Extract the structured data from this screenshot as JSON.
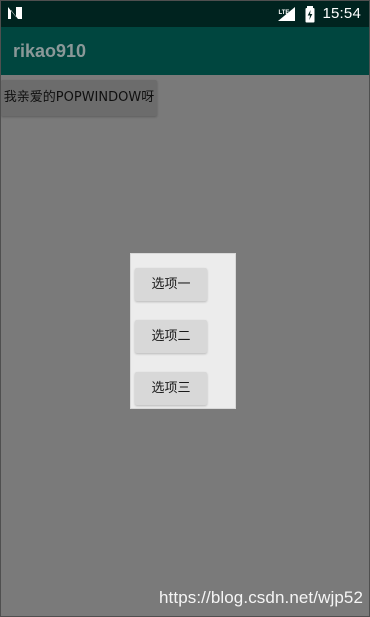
{
  "status_bar": {
    "network_label": "LTE",
    "time": "15:54",
    "icons": {
      "notification": "n-notification-icon",
      "signal": "signal-icon",
      "battery": "battery-charging-icon"
    }
  },
  "app": {
    "title": "rikao910"
  },
  "main": {
    "top_button_label": "我亲爱的POPWINDOW呀"
  },
  "popup": {
    "options": [
      "选项一",
      "选项二",
      "选项三"
    ]
  },
  "watermark": "https://blog.csdn.net/wjp52",
  "colors": {
    "status_bar": "#00231f",
    "app_bar": "#00463f",
    "overlay": "#7a7a7a",
    "popup_background": "#ececec",
    "popup_buttons": "#d8d8d8"
  }
}
